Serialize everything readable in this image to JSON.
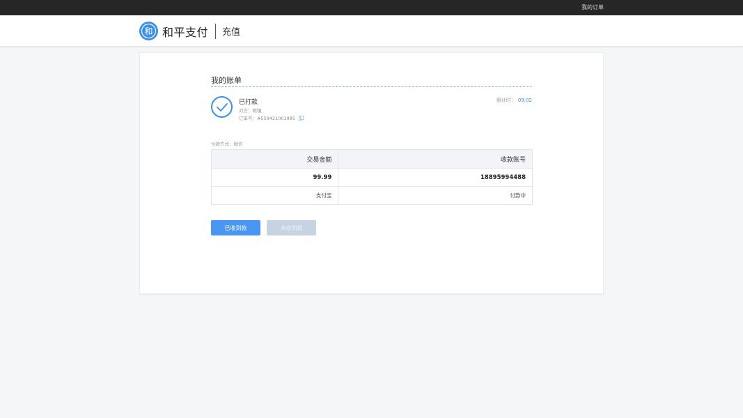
{
  "topbar": {
    "my_orders": "我的订单"
  },
  "header": {
    "logo_char": "和",
    "brand_name": "和平支付",
    "subtitle": "充值"
  },
  "bill": {
    "section_title": "我的账单",
    "status": "已打款",
    "counterparty_label": "对方：",
    "counterparty_value": "阿镜",
    "order_label": "订单号：",
    "order_value": "#559421001985",
    "countdown_label": "倒计时：",
    "countdown_value": "09:02",
    "pay_method_label": "付款方式：",
    "pay_method_value": "微信"
  },
  "table": {
    "headers": [
      "交易金额",
      "收款账号"
    ],
    "row_main": [
      "99.99",
      "18895994488"
    ],
    "row_sub": [
      "支付宝",
      "付款中"
    ]
  },
  "actions": {
    "received": "已收到款",
    "not_received": "未收到款"
  },
  "colors": {
    "accent": "#3b8fe8",
    "primary_button": "#4a96f3",
    "disabled_button": "#c6d3e2",
    "topbar": "#262626"
  }
}
